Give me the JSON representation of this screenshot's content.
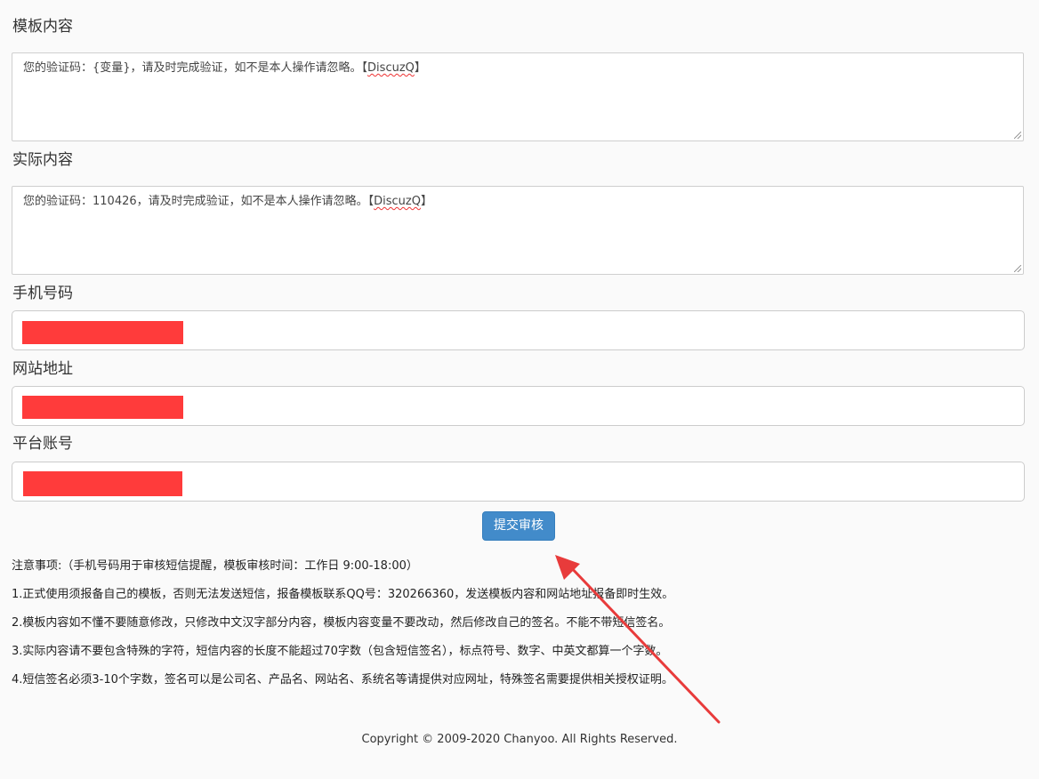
{
  "template": {
    "label": "模板内容",
    "text_before": "您的验证码：{变量}，请及时完成验证，如不是本人操作请忽略。【",
    "brand": "DiscuzQ",
    "text_after": "】"
  },
  "actual": {
    "label": "实际内容",
    "text_before": "您的验证码：110426，请及时完成验证，如不是本人操作请忽略。【",
    "brand": "DiscuzQ",
    "text_after": "】"
  },
  "phone": {
    "label": "手机号码"
  },
  "website": {
    "label": "网站地址"
  },
  "account": {
    "label": "平台账号"
  },
  "submit_label": "提交审核",
  "notes": {
    "title": "注意事项:（手机号码用于审核短信提醒，模板审核时间：工作日 9:00-18:00）",
    "items": [
      "1.正式使用须报备自己的模板，否则无法发送短信，报备模板联系QQ号：320266360，发送模板内容和网站地址报备即时生效。",
      "2.模板内容如不懂不要随意修改，只修改中文汉字部分内容，模板内容变量不要改动，然后修改自己的签名。不能不带短信签名。",
      "3.实际内容请不要包含特殊的字符，短信内容的长度不能超过70字数（包含短信签名），标点符号、数字、中英文都算一个字数。",
      "4.短信签名必须3-10个字数，签名可以是公司名、产品名、网站名、系统名等请提供对应网址，特殊签名需要提供相关授权证明。"
    ]
  },
  "footer": "Copyright © 2009-2020 Chanyoo. All Rights Reserved.",
  "colors": {
    "redaction": "#ff3b3b",
    "button": "#428bca",
    "arrow": "#e83b3b"
  }
}
